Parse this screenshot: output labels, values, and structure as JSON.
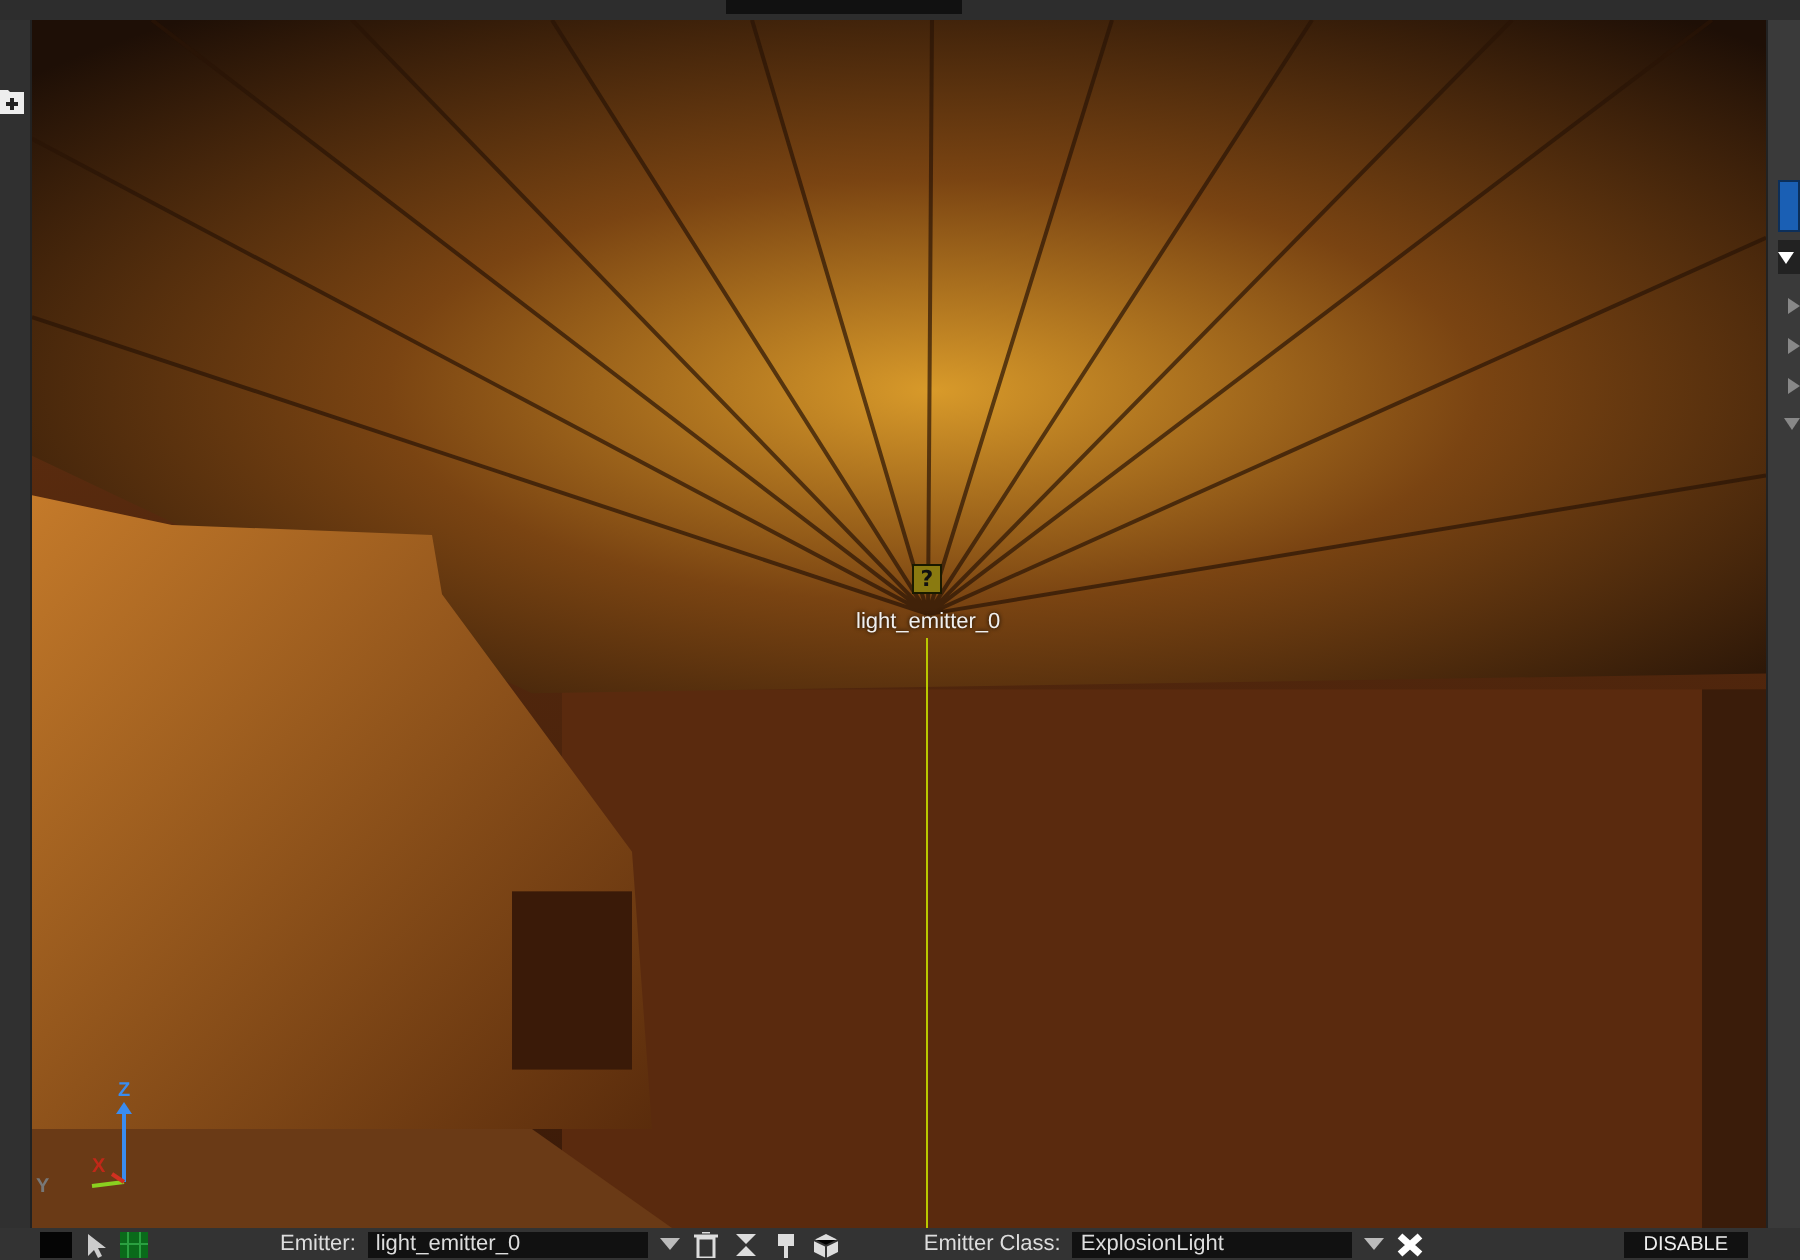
{
  "viewport": {
    "emitter_marker": {
      "glyph": "?",
      "label": "light_emitter_0"
    },
    "axis_gizmo": {
      "z_label": "Z",
      "x_label": "X",
      "y_label": "Y"
    }
  },
  "bottom_bar": {
    "emitter": {
      "label": "Emitter:",
      "value": "light_emitter_0"
    },
    "emitter_class": {
      "label": "Emitter Class:",
      "value": "ExplosionLight"
    },
    "disable_button": "DISABLE"
  }
}
